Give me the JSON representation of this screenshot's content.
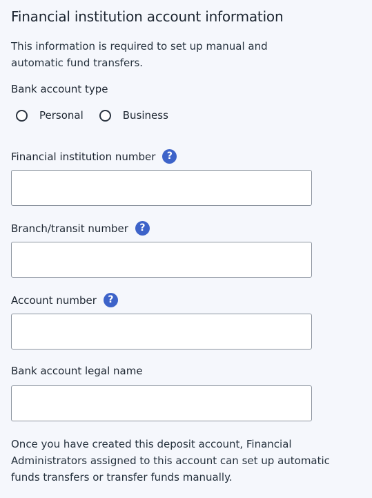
{
  "section": {
    "title": "Financial institution account information",
    "intro": "This information is required to set up manual and automatic fund transfers."
  },
  "account_type": {
    "label": "Bank account type",
    "options": [
      {
        "label": "Personal",
        "selected": false
      },
      {
        "label": "Business",
        "selected": false
      }
    ]
  },
  "fields": {
    "institution_number": {
      "label": "Financial institution number",
      "value": "",
      "help_icon": "question-icon"
    },
    "transit_number": {
      "label": "Branch/transit number",
      "value": "",
      "help_icon": "question-icon"
    },
    "account_number": {
      "label": "Account number",
      "value": "",
      "help_icon": "question-icon"
    },
    "legal_name": {
      "label": "Bank account legal name",
      "value": ""
    }
  },
  "footer_note": "Once you have created this deposit account, Financial Administrators assigned to this account can set up automatic funds transfers or transfer funds manually.",
  "colors": {
    "background": "#f5f7fc",
    "help_icon": "#3d63c9",
    "field_border": "#8b939e",
    "text": "#1c2530"
  }
}
